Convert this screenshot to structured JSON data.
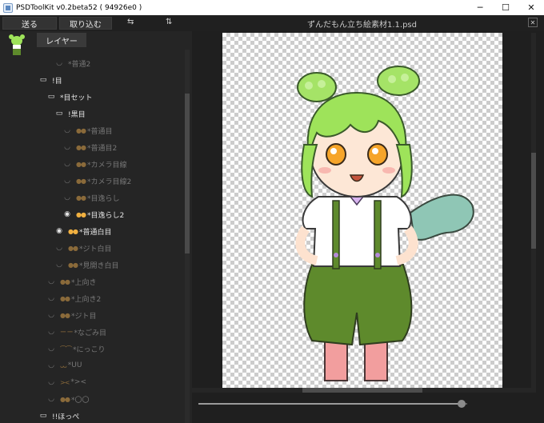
{
  "window": {
    "title": "PSDToolKit v0.2beta52 ( 94926e0 )",
    "controls": [
      "─",
      "☐",
      "✕"
    ]
  },
  "toolbar": {
    "send_label": "送る",
    "import_label": "取り込む",
    "sort_icon_1": "⇆",
    "sort_icon_2": "⇅",
    "document_title": "ずんだもん立ち絵素材1.1.psd",
    "close_label": "✕"
  },
  "left_panel": {
    "tab_label": "レイヤー",
    "rows": [
      {
        "text": "*普通2",
        "indent": 4,
        "dim": true,
        "icon": "eye-hidden",
        "prefix": ""
      },
      {
        "text": "!目",
        "indent": 2,
        "dim": false,
        "icon": "folder",
        "prefix": ""
      },
      {
        "text": "*目セット",
        "indent": 3,
        "dim": false,
        "icon": "folder",
        "prefix": ""
      },
      {
        "text": "!黒目",
        "indent": 4,
        "dim": false,
        "icon": "folder",
        "prefix": ""
      },
      {
        "text": "*普通目",
        "indent": 5,
        "dim": true,
        "icon": "eye-hidden",
        "prefix": "●●"
      },
      {
        "text": "*普通目2",
        "indent": 5,
        "dim": true,
        "icon": "eye-hidden",
        "prefix": "●●"
      },
      {
        "text": "*カメラ目線",
        "indent": 5,
        "dim": true,
        "icon": "eye-hidden",
        "prefix": "●●"
      },
      {
        "text": "*カメラ目線2",
        "indent": 5,
        "dim": true,
        "icon": "eye-hidden",
        "prefix": "●●"
      },
      {
        "text": "*目逸らし",
        "indent": 5,
        "dim": true,
        "icon": "eye-hidden",
        "prefix": "●●"
      },
      {
        "text": "*目逸らし2",
        "indent": 5,
        "dim": false,
        "icon": "eye",
        "prefix": "●●"
      },
      {
        "text": "*普通白目",
        "indent": 4,
        "dim": false,
        "icon": "eye",
        "prefix": "●●"
      },
      {
        "text": "*ジト白目",
        "indent": 4,
        "dim": true,
        "icon": "eye-hidden",
        "prefix": "●●"
      },
      {
        "text": "*見開き白目",
        "indent": 4,
        "dim": true,
        "icon": "eye-hidden",
        "prefix": "●●"
      },
      {
        "text": "*上向き",
        "indent": 3,
        "dim": true,
        "icon": "eye-hidden",
        "prefix": "●●"
      },
      {
        "text": "*上向き2",
        "indent": 3,
        "dim": true,
        "icon": "eye-hidden",
        "prefix": "●●"
      },
      {
        "text": "*ジト目",
        "indent": 3,
        "dim": true,
        "icon": "eye-hidden",
        "prefix": "●●"
      },
      {
        "text": "*なごみ目",
        "indent": 3,
        "dim": true,
        "icon": "eye-hidden",
        "prefix": "ー ー"
      },
      {
        "text": "*にっこり",
        "indent": 3,
        "dim": true,
        "icon": "eye-hidden",
        "prefix": "⌒⌒"
      },
      {
        "text": "*UU",
        "indent": 3,
        "dim": true,
        "icon": "eye-hidden",
        "prefix": "ᴗᴗ"
      },
      {
        "text": "*><",
        "indent": 3,
        "dim": true,
        "icon": "eye-hidden",
        "prefix": "><"
      },
      {
        "text": "*〇〇",
        "indent": 3,
        "dim": true,
        "icon": "eye-hidden",
        "prefix": "●●"
      },
      {
        "text": "!!ほっぺ",
        "indent": 2,
        "dim": false,
        "icon": "folder",
        "prefix": ""
      }
    ]
  },
  "canvas": {
    "zoom_level": 0.98
  },
  "colors": {
    "accent_green": "#8bd84a",
    "suspender_green": "#5e8a2c"
  }
}
